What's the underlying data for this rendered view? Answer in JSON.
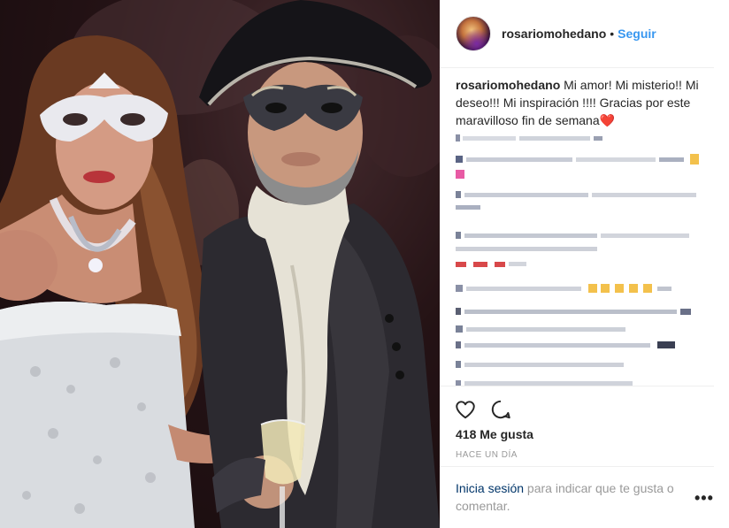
{
  "post": {
    "username": "rosariomohedano",
    "separator_dot": "•",
    "follow_label": "Seguir",
    "caption_text": "Mi amor! Mi misterio!! Mi deseo!!! Mi inspiración !!!! Gracias por este maravilloso fin de semana",
    "caption_emoji": "❤️",
    "likes_label": "418 Me gusta",
    "timestamp": "HACE UN DÍA",
    "login_link": "Inicia sesión",
    "login_text": " para indicar que te gusta o comentar.",
    "more_options": "•••"
  },
  "icons": {
    "like": "heart-outline-icon",
    "comment": "speech-bubble-icon",
    "more": "ellipsis-icon"
  },
  "colors": {
    "link_blue": "#3897f0",
    "text_dark": "#262626",
    "text_muted": "#999999",
    "heart_red": "#e8202a",
    "divider": "#efefef"
  }
}
